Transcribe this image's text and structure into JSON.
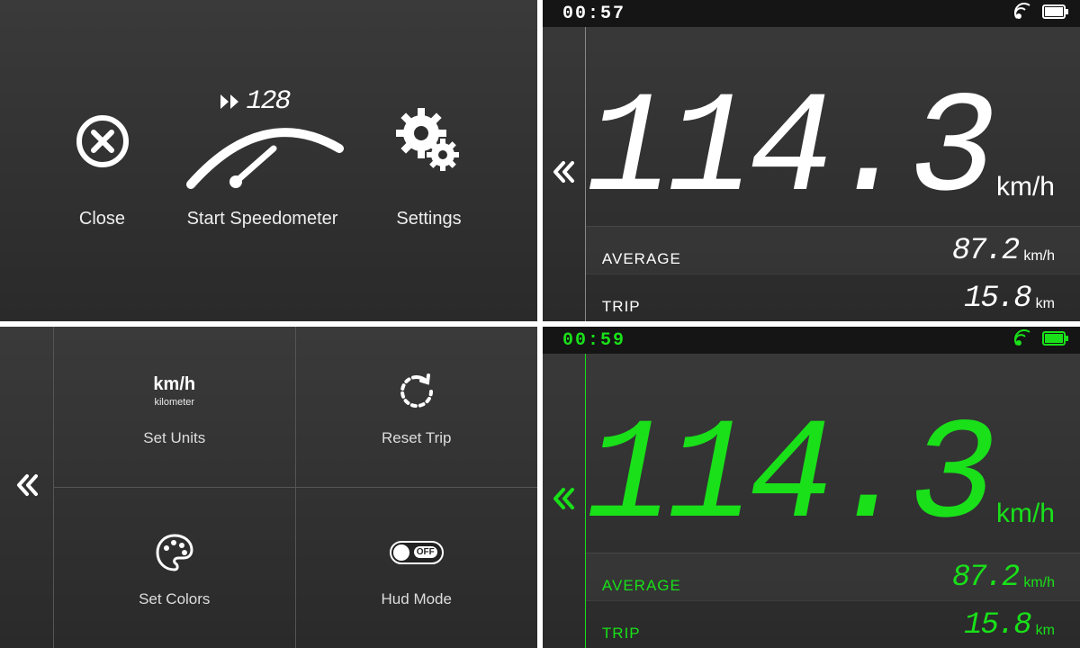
{
  "menu": {
    "close_label": "Close",
    "start_label": "Start Speedometer",
    "settings_label": "Settings",
    "gauge_value": "128"
  },
  "speedo_white": {
    "time": "00:57",
    "speed": "114.3",
    "speed_unit": "km/h",
    "rows": [
      {
        "label": "AVERAGE",
        "value": "87.2",
        "unit": "km/h"
      },
      {
        "label": "TRIP",
        "value": "15.8",
        "unit": "km"
      }
    ]
  },
  "speedo_green": {
    "time": "00:59",
    "speed": "114.3",
    "speed_unit": "km/h",
    "rows": [
      {
        "label": "AVERAGE",
        "value": "87.2",
        "unit": "km/h"
      },
      {
        "label": "TRIP",
        "value": "15.8",
        "unit": "km"
      }
    ]
  },
  "settings": {
    "units_title": "km/h",
    "units_sub": "kilometer",
    "units_label": "Set Units",
    "reset_label": "Reset Trip",
    "colors_label": "Set Colors",
    "hud_label": "Hud Mode",
    "hud_state": "OFF"
  }
}
